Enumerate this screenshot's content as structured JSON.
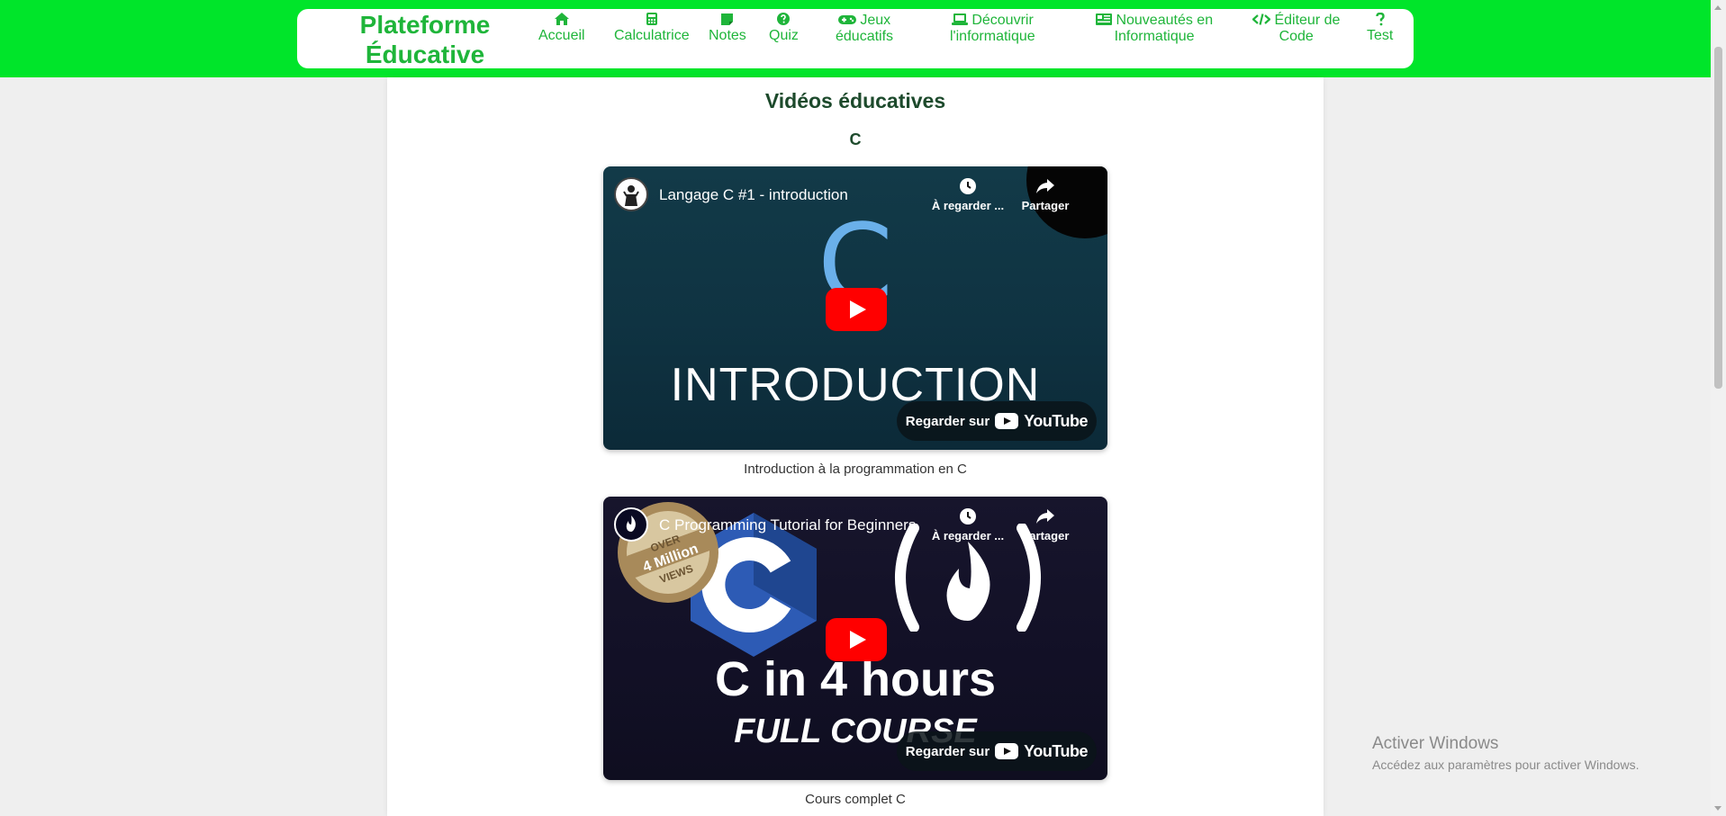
{
  "brand": {
    "line1": "Plateforme",
    "line2": "Éducative"
  },
  "nav": [
    {
      "icon": "home-icon",
      "line1": "Accueil",
      "line2": ""
    },
    {
      "icon": "calculator-icon",
      "line1": "Calculatrice",
      "line2": ""
    },
    {
      "icon": "note-icon",
      "line1": "Notes",
      "line2": ""
    },
    {
      "icon": "question-circle-icon",
      "line1": "Quiz",
      "line2": ""
    },
    {
      "icon": "gamepad-icon",
      "line1": "Jeux",
      "line2": "éducatifs"
    },
    {
      "icon": "laptop-icon",
      "line1": "Découvrir",
      "line2": "l'informatique"
    },
    {
      "icon": "newspaper-icon",
      "line1": "Nouveautés en",
      "line2": "Informatique"
    },
    {
      "icon": "code-icon",
      "line1": "Éditeur de",
      "line2": "Code"
    },
    {
      "icon": "question-icon",
      "line1": "Test",
      "line2": ""
    }
  ],
  "main": {
    "title": "Vidéos éducatives",
    "language": "C",
    "videos": [
      {
        "title": "Langage C #1 - introduction",
        "watch_later": "À regarder ...",
        "share": "Partager",
        "watch_on": "Regarder sur",
        "youtube": "YouTube",
        "thumb_letter": "C",
        "thumb_text": "INTRODUCTION",
        "caption": "Introduction à la programmation en C"
      },
      {
        "title": "C Programming Tutorial for Beginners",
        "watch_later": "À regarder ...",
        "share": "Partager",
        "watch_on": "Regarder sur",
        "youtube": "YouTube",
        "thumb_text": "C in 4 hours",
        "thumb_sub": "FULL COURSE",
        "badge": [
          "OVER",
          "4 Million",
          "VIEWS"
        ],
        "caption": "Cours complet C"
      }
    ]
  },
  "watermark": {
    "line1": "Activer Windows",
    "line2": "Accédez aux paramètres pour activer Windows."
  },
  "colors": {
    "topbar": "#00e52a",
    "brand": "#1fb53a",
    "heading": "#1d4a2c",
    "youtube_red": "#ff0000"
  }
}
